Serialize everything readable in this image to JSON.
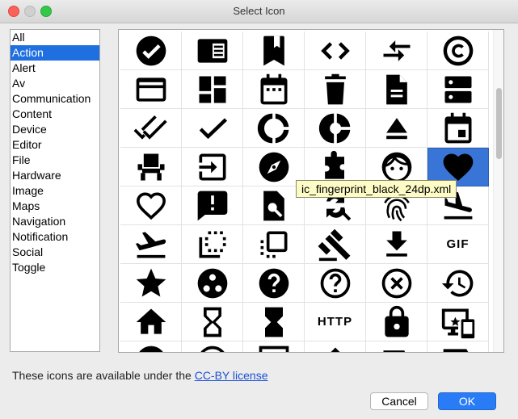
{
  "window": {
    "title": "Select Icon"
  },
  "categories": [
    {
      "label": "All",
      "selected": false
    },
    {
      "label": "Action",
      "selected": true
    },
    {
      "label": "Alert",
      "selected": false
    },
    {
      "label": "Av",
      "selected": false
    },
    {
      "label": "Communication",
      "selected": false
    },
    {
      "label": "Content",
      "selected": false
    },
    {
      "label": "Device",
      "selected": false
    },
    {
      "label": "Editor",
      "selected": false
    },
    {
      "label": "File",
      "selected": false
    },
    {
      "label": "Hardware",
      "selected": false
    },
    {
      "label": "Image",
      "selected": false
    },
    {
      "label": "Maps",
      "selected": false
    },
    {
      "label": "Navigation",
      "selected": false
    },
    {
      "label": "Notification",
      "selected": false
    },
    {
      "label": "Social",
      "selected": false
    },
    {
      "label": "Toggle",
      "selected": false
    }
  ],
  "icons": [
    "check-circle-icon",
    "chrome-reader-mode-icon",
    "bookmark-icon",
    "code-icon",
    "compare-arrows-icon",
    "copyright-icon",
    "credit-card-icon",
    "dashboard-icon",
    "date-range-icon",
    "delete-icon",
    "description-icon",
    "dns-icon",
    "done-all-icon",
    "done-icon",
    "donut-large-icon",
    "donut-small-icon",
    "eject-icon",
    "event-icon",
    "event-seat-icon",
    "exit-to-app-icon",
    "explore-icon",
    "extension-icon",
    "face-icon",
    "favorite-icon",
    "favorite-border-icon",
    "feedback-icon",
    "find-in-page-icon",
    "find-replace-icon",
    "fingerprint-icon",
    "flight-land-icon",
    "flight-takeoff-icon",
    "flip-to-back-icon",
    "flip-to-front-icon",
    "gavel-icon",
    "get-app-icon",
    "gif-icon",
    "grade-icon",
    "group-work-icon",
    "help-icon",
    "help-outline-icon",
    "highlight-off-icon",
    "history-icon",
    "home-icon",
    "hourglass-empty-icon",
    "hourglass-full-icon",
    "http-icon",
    "https-icon",
    "important-devices-icon",
    "info-icon",
    "info-outline-icon",
    "input-icon",
    "invert-colors-icon",
    "label-icon",
    "label-outline-icon"
  ],
  "icon_text": {
    "gif": "GIF",
    "http": "HTTP"
  },
  "selected_icon": "favorite-icon",
  "tooltip": "ic_fingerprint_black_24dp.xml",
  "license": {
    "prefix": "These icons are available under the ",
    "link": "CC-BY license"
  },
  "buttons": {
    "cancel": "Cancel",
    "ok": "OK"
  },
  "colors": {
    "selection": "#1f6fe0",
    "cell_selection": "#3875d7",
    "ok_button": "#2a7cf6",
    "tooltip_bg": "#fdfcc6"
  }
}
